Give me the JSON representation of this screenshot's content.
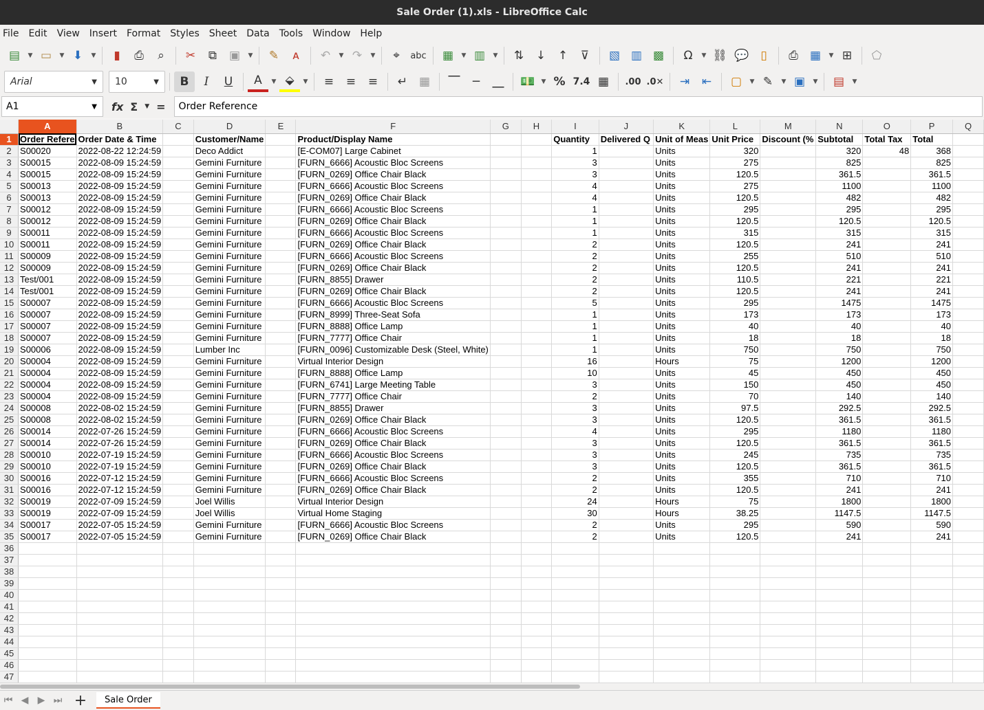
{
  "window": {
    "title": "Sale Order (1).xls - LibreOffice Calc"
  },
  "menu": [
    "File",
    "Edit",
    "View",
    "Insert",
    "Format",
    "Styles",
    "Sheet",
    "Data",
    "Tools",
    "Window",
    "Help"
  ],
  "format_toolbar": {
    "font_name": "Arial",
    "font_size": "10"
  },
  "formula_bar": {
    "cell_ref": "A1",
    "content": "Order Reference"
  },
  "columns": [
    "A",
    "B",
    "C",
    "D",
    "E",
    "F",
    "G",
    "H",
    "I",
    "J",
    "K",
    "L",
    "M",
    "N",
    "O",
    "P",
    "Q"
  ],
  "headers": [
    "Order Refere",
    "Order Date & Time",
    "",
    "Customer/Name",
    "",
    "Product/Display Name",
    "",
    "",
    "Quantity",
    "Delivered Q",
    "Unit of Meas",
    "Unit Price",
    "Discount (%",
    "Subtotal",
    "Total Tax",
    "Total",
    ""
  ],
  "rows": [
    [
      "S00020",
      "2022-08-22 12:24:59",
      "Deco Addict",
      "[E-COM07] Large Cabinet",
      "1",
      "",
      "Units",
      "320",
      "",
      "320",
      "48",
      "368"
    ],
    [
      "S00015",
      "2022-08-09 15:24:59",
      "Gemini Furniture",
      "[FURN_6666] Acoustic Bloc Screens",
      "3",
      "",
      "Units",
      "275",
      "",
      "825",
      "",
      "825"
    ],
    [
      "S00015",
      "2022-08-09 15:24:59",
      "Gemini Furniture",
      "[FURN_0269] Office Chair Black",
      "3",
      "",
      "Units",
      "120.5",
      "",
      "361.5",
      "",
      "361.5"
    ],
    [
      "S00013",
      "2022-08-09 15:24:59",
      "Gemini Furniture",
      "[FURN_6666] Acoustic Bloc Screens",
      "4",
      "",
      "Units",
      "275",
      "",
      "1100",
      "",
      "1100"
    ],
    [
      "S00013",
      "2022-08-09 15:24:59",
      "Gemini Furniture",
      "[FURN_0269] Office Chair Black",
      "4",
      "",
      "Units",
      "120.5",
      "",
      "482",
      "",
      "482"
    ],
    [
      "S00012",
      "2022-08-09 15:24:59",
      "Gemini Furniture",
      "[FURN_6666] Acoustic Bloc Screens",
      "1",
      "",
      "Units",
      "295",
      "",
      "295",
      "",
      "295"
    ],
    [
      "S00012",
      "2022-08-09 15:24:59",
      "Gemini Furniture",
      "[FURN_0269] Office Chair Black",
      "1",
      "",
      "Units",
      "120.5",
      "",
      "120.5",
      "",
      "120.5"
    ],
    [
      "S00011",
      "2022-08-09 15:24:59",
      "Gemini Furniture",
      "[FURN_6666] Acoustic Bloc Screens",
      "1",
      "",
      "Units",
      "315",
      "",
      "315",
      "",
      "315"
    ],
    [
      "S00011",
      "2022-08-09 15:24:59",
      "Gemini Furniture",
      "[FURN_0269] Office Chair Black",
      "2",
      "",
      "Units",
      "120.5",
      "",
      "241",
      "",
      "241"
    ],
    [
      "S00009",
      "2022-08-09 15:24:59",
      "Gemini Furniture",
      "[FURN_6666] Acoustic Bloc Screens",
      "2",
      "",
      "Units",
      "255",
      "",
      "510",
      "",
      "510"
    ],
    [
      "S00009",
      "2022-08-09 15:24:59",
      "Gemini Furniture",
      "[FURN_0269] Office Chair Black",
      "2",
      "",
      "Units",
      "120.5",
      "",
      "241",
      "",
      "241"
    ],
    [
      "Test/001",
      "2022-08-09 15:24:59",
      "Gemini Furniture",
      "[FURN_8855] Drawer",
      "2",
      "",
      "Units",
      "110.5",
      "",
      "221",
      "",
      "221"
    ],
    [
      "Test/001",
      "2022-08-09 15:24:59",
      "Gemini Furniture",
      "[FURN_0269] Office Chair Black",
      "2",
      "",
      "Units",
      "120.5",
      "",
      "241",
      "",
      "241"
    ],
    [
      "S00007",
      "2022-08-09 15:24:59",
      "Gemini Furniture",
      "[FURN_6666] Acoustic Bloc Screens",
      "5",
      "",
      "Units",
      "295",
      "",
      "1475",
      "",
      "1475"
    ],
    [
      "S00007",
      "2022-08-09 15:24:59",
      "Gemini Furniture",
      "[FURN_8999] Three-Seat Sofa",
      "1",
      "",
      "Units",
      "173",
      "",
      "173",
      "",
      "173"
    ],
    [
      "S00007",
      "2022-08-09 15:24:59",
      "Gemini Furniture",
      "[FURN_8888] Office Lamp",
      "1",
      "",
      "Units",
      "40",
      "",
      "40",
      "",
      "40"
    ],
    [
      "S00007",
      "2022-08-09 15:24:59",
      "Gemini Furniture",
      "[FURN_7777] Office Chair",
      "1",
      "",
      "Units",
      "18",
      "",
      "18",
      "",
      "18"
    ],
    [
      "S00006",
      "2022-08-09 15:24:59",
      "Lumber Inc",
      "[FURN_0096] Customizable Desk (Steel, White)",
      "1",
      "",
      "Units",
      "750",
      "",
      "750",
      "",
      "750"
    ],
    [
      "S00004",
      "2022-08-09 15:24:59",
      "Gemini Furniture",
      "Virtual Interior Design",
      "16",
      "",
      "Hours",
      "75",
      "",
      "1200",
      "",
      "1200"
    ],
    [
      "S00004",
      "2022-08-09 15:24:59",
      "Gemini Furniture",
      "[FURN_8888] Office Lamp",
      "10",
      "",
      "Units",
      "45",
      "",
      "450",
      "",
      "450"
    ],
    [
      "S00004",
      "2022-08-09 15:24:59",
      "Gemini Furniture",
      "[FURN_6741] Large Meeting Table",
      "3",
      "",
      "Units",
      "150",
      "",
      "450",
      "",
      "450"
    ],
    [
      "S00004",
      "2022-08-09 15:24:59",
      "Gemini Furniture",
      "[FURN_7777] Office Chair",
      "2",
      "",
      "Units",
      "70",
      "",
      "140",
      "",
      "140"
    ],
    [
      "S00008",
      "2022-08-02 15:24:59",
      "Gemini Furniture",
      "[FURN_8855] Drawer",
      "3",
      "",
      "Units",
      "97.5",
      "",
      "292.5",
      "",
      "292.5"
    ],
    [
      "S00008",
      "2022-08-02 15:24:59",
      "Gemini Furniture",
      "[FURN_0269] Office Chair Black",
      "3",
      "",
      "Units",
      "120.5",
      "",
      "361.5",
      "",
      "361.5"
    ],
    [
      "S00014",
      "2022-07-26 15:24:59",
      "Gemini Furniture",
      "[FURN_6666] Acoustic Bloc Screens",
      "4",
      "",
      "Units",
      "295",
      "",
      "1180",
      "",
      "1180"
    ],
    [
      "S00014",
      "2022-07-26 15:24:59",
      "Gemini Furniture",
      "[FURN_0269] Office Chair Black",
      "3",
      "",
      "Units",
      "120.5",
      "",
      "361.5",
      "",
      "361.5"
    ],
    [
      "S00010",
      "2022-07-19 15:24:59",
      "Gemini Furniture",
      "[FURN_6666] Acoustic Bloc Screens",
      "3",
      "",
      "Units",
      "245",
      "",
      "735",
      "",
      "735"
    ],
    [
      "S00010",
      "2022-07-19 15:24:59",
      "Gemini Furniture",
      "[FURN_0269] Office Chair Black",
      "3",
      "",
      "Units",
      "120.5",
      "",
      "361.5",
      "",
      "361.5"
    ],
    [
      "S00016",
      "2022-07-12 15:24:59",
      "Gemini Furniture",
      "[FURN_6666] Acoustic Bloc Screens",
      "2",
      "",
      "Units",
      "355",
      "",
      "710",
      "",
      "710"
    ],
    [
      "S00016",
      "2022-07-12 15:24:59",
      "Gemini Furniture",
      "[FURN_0269] Office Chair Black",
      "2",
      "",
      "Units",
      "120.5",
      "",
      "241",
      "",
      "241"
    ],
    [
      "S00019",
      "2022-07-09 15:24:59",
      "Joel Willis",
      "Virtual Interior Design",
      "24",
      "",
      "Hours",
      "75",
      "",
      "1800",
      "",
      "1800"
    ],
    [
      "S00019",
      "2022-07-09 15:24:59",
      "Joel Willis",
      "Virtual Home Staging",
      "30",
      "",
      "Hours",
      "38.25",
      "",
      "1147.5",
      "",
      "1147.5"
    ],
    [
      "S00017",
      "2022-07-05 15:24:59",
      "Gemini Furniture",
      "[FURN_6666] Acoustic Bloc Screens",
      "2",
      "",
      "Units",
      "295",
      "",
      "590",
      "",
      "590"
    ],
    [
      "S00017",
      "2022-07-05 15:24:59",
      "Gemini Furniture",
      "[FURN_0269] Office Chair Black",
      "2",
      "",
      "Units",
      "120.5",
      "",
      "241",
      "",
      "241"
    ]
  ],
  "total_rows_visible": 47,
  "sheet_tabs": [
    "Sale Order"
  ],
  "colors": {
    "accent": "#e8531f",
    "titlebar": "#2c2c2c"
  }
}
